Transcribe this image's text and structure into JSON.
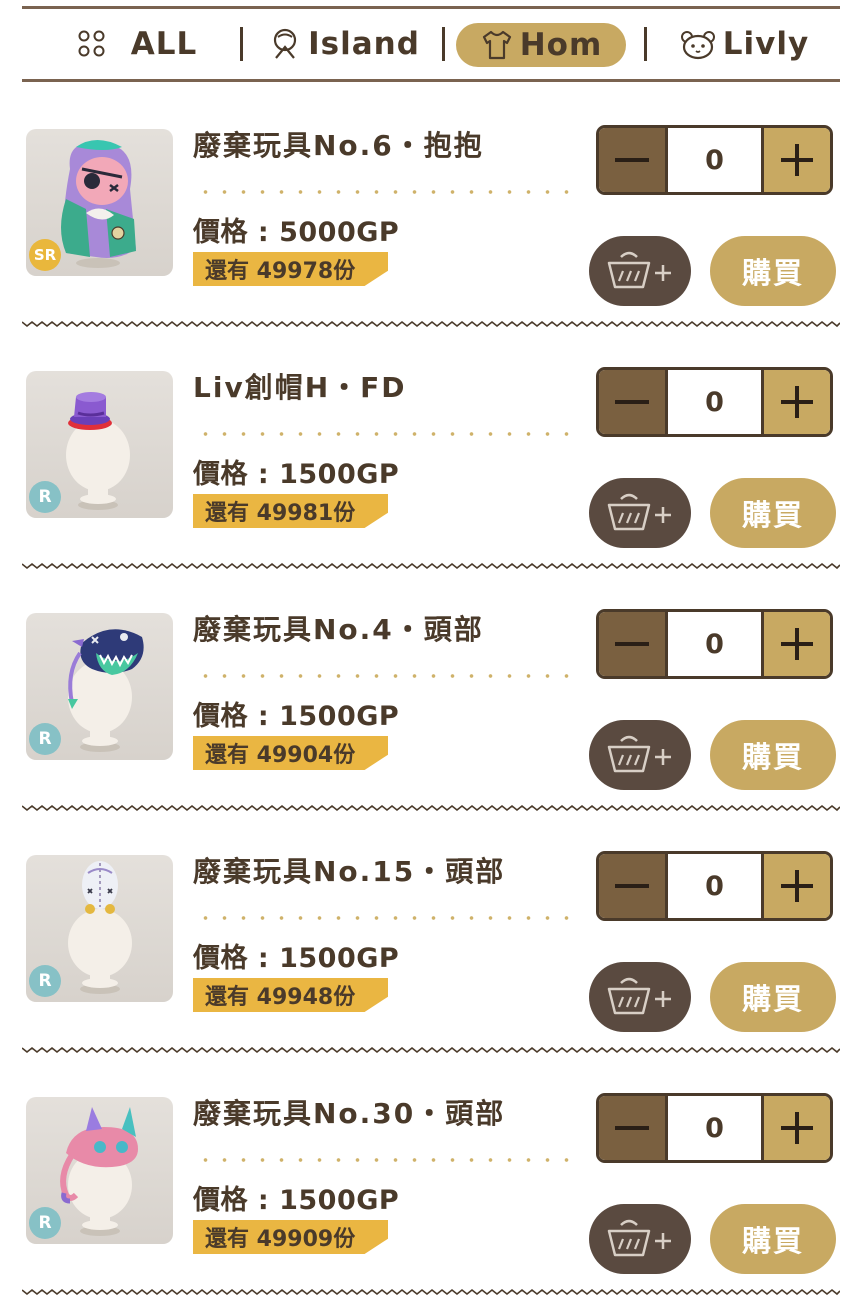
{
  "tabs": [
    {
      "label": "ALL",
      "icon": "grid-dots-icon",
      "active": false
    },
    {
      "label": "Island",
      "icon": "island-icon",
      "active": false
    },
    {
      "label": "Hom",
      "icon": "shirt-icon",
      "active": true
    },
    {
      "label": "Livly",
      "icon": "livly-face-icon",
      "active": false
    }
  ],
  "colors": {
    "accent": "#c8a962",
    "dark_brown": "#4a3a2a",
    "stock_tag": "#eab642",
    "rarity_sr": "#e9b73c",
    "rarity_r": "#87c1c6",
    "cart_button": "#5a4a40"
  },
  "buy_label": "購買",
  "products": [
    {
      "name": "廢棄玩具No.6・抱抱",
      "price": "價格 : 5000GP",
      "stock": "還有 49978份",
      "rarity": "SR",
      "quantity": "0",
      "item_image": "stitched-plush-toy-hug"
    },
    {
      "name": "Liv創帽H・FD",
      "price": "價格 : 1500GP",
      "stock": "還有 49981份",
      "rarity": "R",
      "quantity": "0",
      "item_image": "purple-top-hat"
    },
    {
      "name": "廢棄玩具No.4・頭部",
      "price": "價格 : 1500GP",
      "stock": "還有 49904份",
      "rarity": "R",
      "quantity": "0",
      "item_image": "monster-plush-head"
    },
    {
      "name": "廢棄玩具No.15・頭部",
      "price": "價格 : 1500GP",
      "stock": "還有 49948份",
      "rarity": "R",
      "quantity": "0",
      "item_image": "stitched-egg-head"
    },
    {
      "name": "廢棄玩具No.30・頭部",
      "price": "價格 : 1500GP",
      "stock": "還有 49909份",
      "rarity": "R",
      "quantity": "0",
      "item_image": "pink-cat-plush-head"
    }
  ]
}
